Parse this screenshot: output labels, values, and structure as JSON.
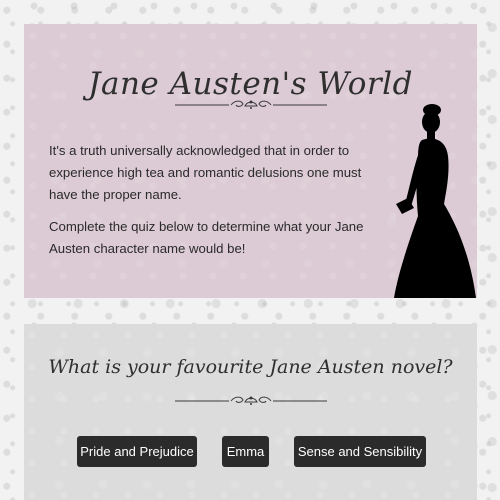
{
  "intro": {
    "title": "Jane Austen's World",
    "paragraph1": "It's a truth universally acknowledged that in order to experience high tea and romantic delusions one must have the proper name.",
    "paragraph2": "Complete the quiz below to determine what your Jane Austen character name would be!"
  },
  "quiz": {
    "question": "What is your favourite Jane Austen novel?",
    "answers": [
      {
        "label": "Pride and Prejudice"
      },
      {
        "label": "Emma"
      },
      {
        "label": "Sense and Sensibility"
      }
    ]
  },
  "icons": {
    "divider": "ornamental-divider-icon",
    "figure": "lady-silhouette-icon"
  },
  "colors": {
    "intro_background": "#dccbd4",
    "quiz_background": "#dcdcdc",
    "button_background": "#2b2b2b",
    "button_text": "#ffffff",
    "heading_text": "#2f2f2f"
  }
}
